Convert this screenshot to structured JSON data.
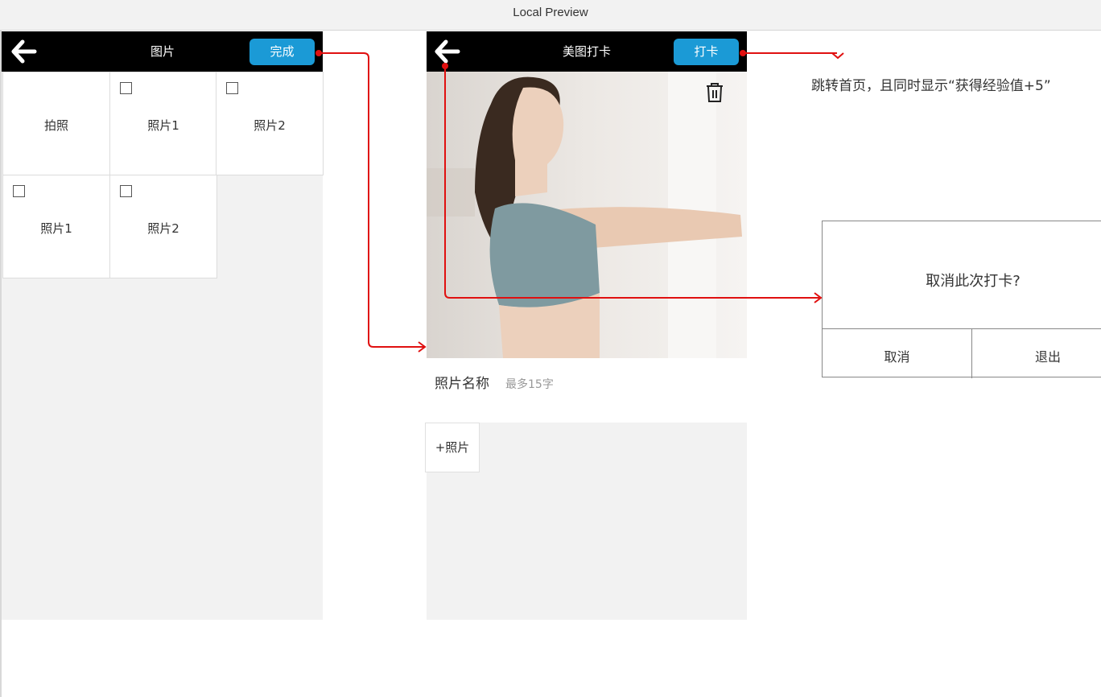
{
  "window": {
    "title": "Local Preview"
  },
  "picker": {
    "title": "图片",
    "done_label": "完成",
    "tiles": [
      {
        "label": "拍照",
        "checkbox": false
      },
      {
        "label": "照片1",
        "checkbox": true
      },
      {
        "label": "照片2",
        "checkbox": true
      },
      {
        "label": "照片1",
        "checkbox": true
      },
      {
        "label": "照片2",
        "checkbox": true
      }
    ]
  },
  "checkin": {
    "title": "美图打卡",
    "submit_label": "打卡",
    "photo_name_label": "照片名称",
    "photo_name_placeholder": "最多15字",
    "add_photo_label": "+照片"
  },
  "annotations": {
    "submit_note": "跳转首页，且同时显示“获得经验值+5”"
  },
  "dialog": {
    "message": "取消此次打卡?",
    "cancel_label": "取消",
    "exit_label": "退出"
  },
  "colors": {
    "accent": "#1b9ad6",
    "nav": "#000000",
    "arrow": "#e01010"
  },
  "icons": {
    "back": "back-arrow-icon",
    "trash": "trash-icon",
    "checkbox": "checkbox-icon"
  }
}
